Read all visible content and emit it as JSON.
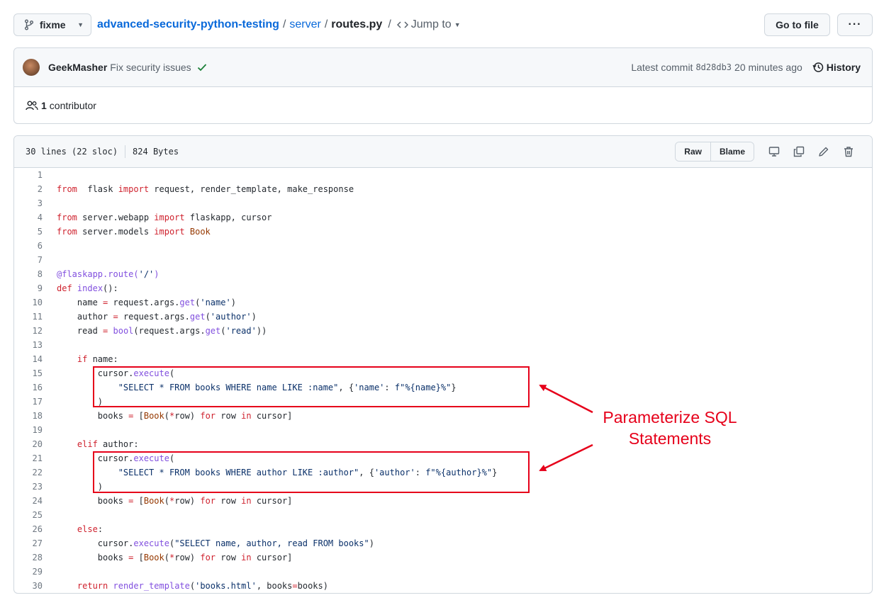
{
  "breadcrumb": {
    "branch": "fixme",
    "repo": "advanced-security-python-testing",
    "dir": "server",
    "file": "routes.py",
    "jump_to": "Jump to"
  },
  "toolbar": {
    "go_to_file": "Go to file",
    "more": "···"
  },
  "commit": {
    "author": "GeekMasher",
    "message": "Fix security issues",
    "latest_label": "Latest commit",
    "sha": "8d28db3",
    "time": "20 minutes ago",
    "history": "History"
  },
  "contributors": {
    "count": "1",
    "label": "contributor"
  },
  "file": {
    "lines_info": "30 lines (22 sloc)",
    "size": "824 Bytes",
    "raw": "Raw",
    "blame": "Blame"
  },
  "code": [
    {
      "n": "1",
      "tokens": []
    },
    {
      "n": "2",
      "tokens": [
        [
          "kw",
          "from"
        ],
        [
          "",
          "  flask "
        ],
        [
          "kw",
          "import"
        ],
        [
          "",
          " request, render_template, make_response"
        ]
      ]
    },
    {
      "n": "3",
      "tokens": []
    },
    {
      "n": "4",
      "tokens": [
        [
          "kw",
          "from"
        ],
        [
          "",
          " server.webapp "
        ],
        [
          "kw",
          "import"
        ],
        [
          "",
          " flaskapp, cursor"
        ]
      ]
    },
    {
      "n": "5",
      "tokens": [
        [
          "kw",
          "from"
        ],
        [
          "",
          " server.models "
        ],
        [
          "kw",
          "import"
        ],
        [
          "",
          " "
        ],
        [
          "cls",
          "Book"
        ]
      ]
    },
    {
      "n": "6",
      "tokens": []
    },
    {
      "n": "7",
      "tokens": []
    },
    {
      "n": "8",
      "tokens": [
        [
          "dec",
          "@flaskapp.route("
        ],
        [
          "str",
          "'/'"
        ],
        [
          "dec",
          ")"
        ]
      ]
    },
    {
      "n": "9",
      "tokens": [
        [
          "kw",
          "def"
        ],
        [
          "",
          " "
        ],
        [
          "fn",
          "index"
        ],
        [
          "",
          "():"
        ]
      ]
    },
    {
      "n": "10",
      "tokens": [
        [
          "",
          "    name "
        ],
        [
          "kw",
          "="
        ],
        [
          "",
          " request.args."
        ],
        [
          "fn",
          "get"
        ],
        [
          "",
          "("
        ],
        [
          "str",
          "'name'"
        ],
        [
          "",
          ")"
        ]
      ]
    },
    {
      "n": "11",
      "tokens": [
        [
          "",
          "    author "
        ],
        [
          "kw",
          "="
        ],
        [
          "",
          " request.args."
        ],
        [
          "fn",
          "get"
        ],
        [
          "",
          "("
        ],
        [
          "str",
          "'author'"
        ],
        [
          "",
          ")"
        ]
      ]
    },
    {
      "n": "12",
      "tokens": [
        [
          "",
          "    read "
        ],
        [
          "kw",
          "="
        ],
        [
          "",
          " "
        ],
        [
          "fn",
          "bool"
        ],
        [
          "",
          "(request.args."
        ],
        [
          "fn",
          "get"
        ],
        [
          "",
          "("
        ],
        [
          "str",
          "'read'"
        ],
        [
          "",
          "))"
        ]
      ]
    },
    {
      "n": "13",
      "tokens": []
    },
    {
      "n": "14",
      "tokens": [
        [
          "",
          "    "
        ],
        [
          "kw",
          "if"
        ],
        [
          "",
          " name:"
        ]
      ]
    },
    {
      "n": "15",
      "tokens": [
        [
          "",
          "        cursor."
        ],
        [
          "fn",
          "execute"
        ],
        [
          "",
          "("
        ]
      ]
    },
    {
      "n": "16",
      "tokens": [
        [
          "",
          "            "
        ],
        [
          "str",
          "\"SELECT * FROM books WHERE name LIKE :name\""
        ],
        [
          "",
          ", {"
        ],
        [
          "str",
          "'name'"
        ],
        [
          "",
          ": "
        ],
        [
          "str",
          "f\"%{name}%\""
        ],
        [
          "",
          "}"
        ]
      ]
    },
    {
      "n": "17",
      "tokens": [
        [
          "",
          "        )"
        ]
      ]
    },
    {
      "n": "18",
      "tokens": [
        [
          "",
          "        books "
        ],
        [
          "kw",
          "="
        ],
        [
          "",
          " ["
        ],
        [
          "cls",
          "Book"
        ],
        [
          "",
          "("
        ],
        [
          "kw",
          "*"
        ],
        [
          "",
          "row) "
        ],
        [
          "kw",
          "for"
        ],
        [
          "",
          " row "
        ],
        [
          "kw",
          "in"
        ],
        [
          "",
          " cursor]"
        ]
      ]
    },
    {
      "n": "19",
      "tokens": []
    },
    {
      "n": "20",
      "tokens": [
        [
          "",
          "    "
        ],
        [
          "kw",
          "elif"
        ],
        [
          "",
          " author:"
        ]
      ]
    },
    {
      "n": "21",
      "tokens": [
        [
          "",
          "        cursor."
        ],
        [
          "fn",
          "execute"
        ],
        [
          "",
          "("
        ]
      ]
    },
    {
      "n": "22",
      "tokens": [
        [
          "",
          "            "
        ],
        [
          "str",
          "\"SELECT * FROM books WHERE author LIKE :author\""
        ],
        [
          "",
          ", {"
        ],
        [
          "str",
          "'author'"
        ],
        [
          "",
          ": "
        ],
        [
          "str",
          "f\"%{author}%\""
        ],
        [
          "",
          "}"
        ]
      ]
    },
    {
      "n": "23",
      "tokens": [
        [
          "",
          "        )"
        ]
      ]
    },
    {
      "n": "24",
      "tokens": [
        [
          "",
          "        books "
        ],
        [
          "kw",
          "="
        ],
        [
          "",
          " ["
        ],
        [
          "cls",
          "Book"
        ],
        [
          "",
          "("
        ],
        [
          "kw",
          "*"
        ],
        [
          "",
          "row) "
        ],
        [
          "kw",
          "for"
        ],
        [
          "",
          " row "
        ],
        [
          "kw",
          "in"
        ],
        [
          "",
          " cursor]"
        ]
      ]
    },
    {
      "n": "25",
      "tokens": []
    },
    {
      "n": "26",
      "tokens": [
        [
          "",
          "    "
        ],
        [
          "kw",
          "else"
        ],
        [
          "",
          ":"
        ]
      ]
    },
    {
      "n": "27",
      "tokens": [
        [
          "",
          "        cursor."
        ],
        [
          "fn",
          "execute"
        ],
        [
          "",
          "("
        ],
        [
          "str",
          "\"SELECT name, author, read FROM books\""
        ],
        [
          "",
          ")"
        ]
      ]
    },
    {
      "n": "28",
      "tokens": [
        [
          "",
          "        books "
        ],
        [
          "kw",
          "="
        ],
        [
          "",
          " ["
        ],
        [
          "cls",
          "Book"
        ],
        [
          "",
          "("
        ],
        [
          "kw",
          "*"
        ],
        [
          "",
          "row) "
        ],
        [
          "kw",
          "for"
        ],
        [
          "",
          " row "
        ],
        [
          "kw",
          "in"
        ],
        [
          "",
          " cursor]"
        ]
      ]
    },
    {
      "n": "29",
      "tokens": []
    },
    {
      "n": "30",
      "tokens": [
        [
          "",
          "    "
        ],
        [
          "kw",
          "return"
        ],
        [
          "",
          " "
        ],
        [
          "fn",
          "render_template"
        ],
        [
          "",
          "("
        ],
        [
          "str",
          "'books.html'"
        ],
        [
          "",
          ", books"
        ],
        [
          "kw",
          "="
        ],
        [
          "",
          "books)"
        ]
      ]
    }
  ],
  "annotation": {
    "line1": "Parameterize SQL",
    "line2": "Statements",
    "color": "#e6001a"
  }
}
